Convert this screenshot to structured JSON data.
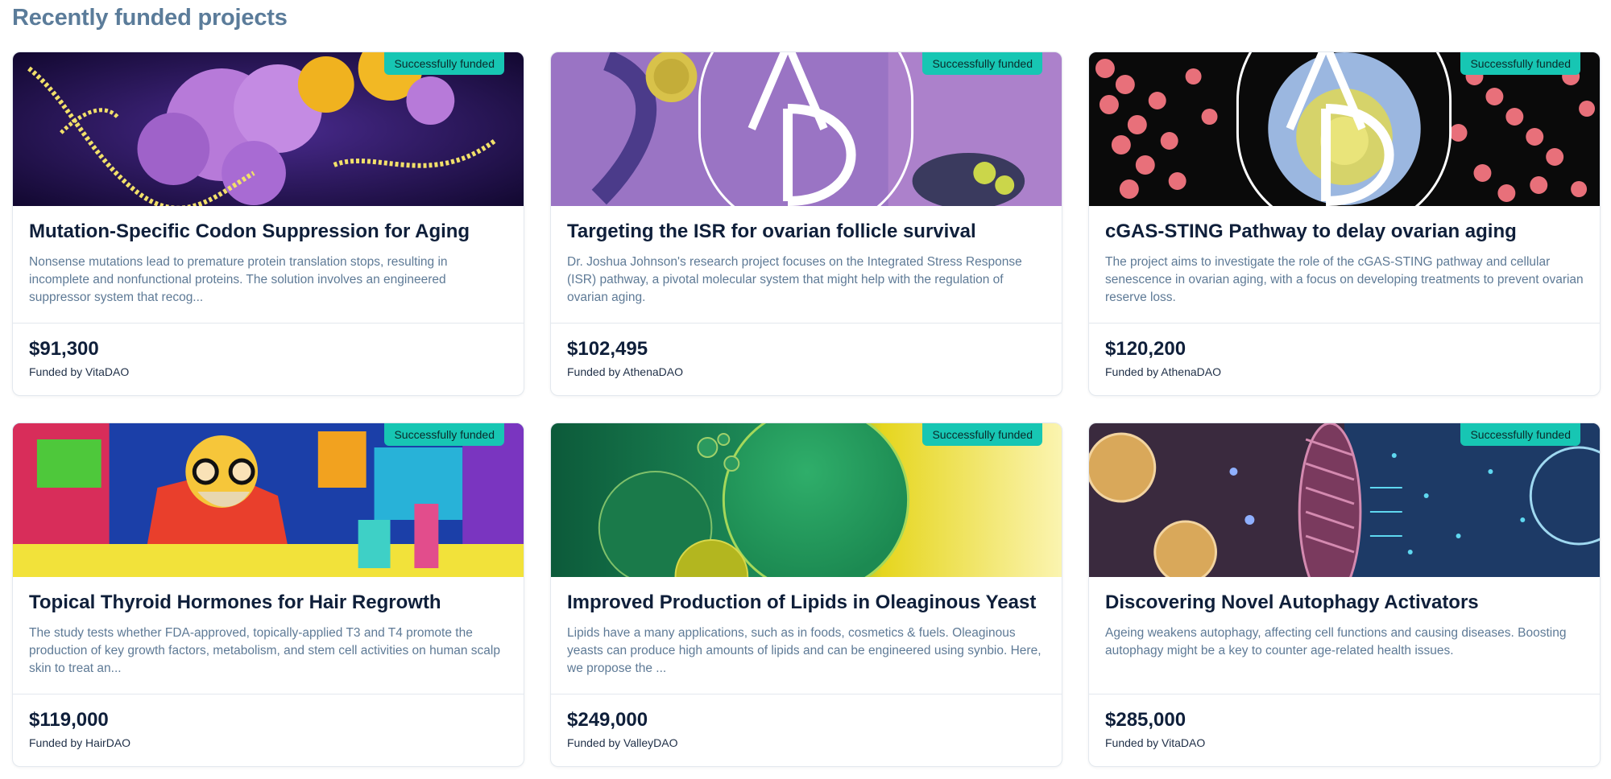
{
  "page": {
    "title": "Recently funded projects"
  },
  "colors": {
    "heading": "#5b7c9a",
    "badge": "#17c6b3",
    "title": "#0f1f3a",
    "description": "#5e7a96",
    "border": "#e3e8ee"
  },
  "cards": [
    {
      "badge": "Successfully funded",
      "title": "Mutation-Specific Codon Suppression for Aging",
      "description": "Nonsense mutations lead to premature protein translation stops, resulting in incomplete and nonfunctional proteins. The solution involves an engineered suppressor system that recog...",
      "amount": "$91,300",
      "funder": "Funded by VitaDAO",
      "image_icon": "protein-structure-image"
    },
    {
      "badge": "Successfully funded",
      "title": "Targeting the ISR for ovarian follicle survival",
      "description": "Dr. Joshua Johnson's research project focuses on the Integrated Stress Response (ISR) pathway, a pivotal molecular system that might help with the regulation of ovarian aging.",
      "amount": "$102,495",
      "funder": "Funded by AthenaDAO",
      "image_icon": "athenadao-follicle-image"
    },
    {
      "badge": "Successfully funded",
      "title": "cGAS-STING Pathway to delay ovarian aging",
      "description": "The project aims to investigate the role of the cGAS-STING pathway and cellular senescence in ovarian aging, with a focus on developing treatments to prevent ovarian reserve loss.",
      "amount": "$120,200",
      "funder": "Funded by AthenaDAO",
      "image_icon": "athenadao-cells-image"
    },
    {
      "badge": "Successfully funded",
      "title": "Topical Thyroid Hormones for Hair Regrowth",
      "description": "The study tests whether FDA-approved, topically-applied T3 and T4 promote the production of key growth factors, metabolism, and stem cell activities on human scalp skin to treat an...",
      "amount": "$119,000",
      "funder": "Funded by HairDAO",
      "image_icon": "psychedelic-scientist-image"
    },
    {
      "badge": "Successfully funded",
      "title": "Improved Production of Lipids in Oleaginous Yeast",
      "description": "Lipids have a many applications, such as in foods, cosmetics & fuels. Oleaginous yeasts can produce high amounts of lipids and can be engineered using synbio. Here, we propose the ...",
      "amount": "$249,000",
      "funder": "Funded by ValleyDAO",
      "image_icon": "lipid-bubbles-image"
    },
    {
      "badge": "Successfully funded",
      "title": "Discovering Novel Autophagy Activators",
      "description": "Ageing weakens autophagy, affecting cell functions and causing diseases. Boosting autophagy might be a key to counter age-related health issues.",
      "amount": "$285,000",
      "funder": "Funded by VitaDAO",
      "image_icon": "mitochondria-image"
    }
  ]
}
